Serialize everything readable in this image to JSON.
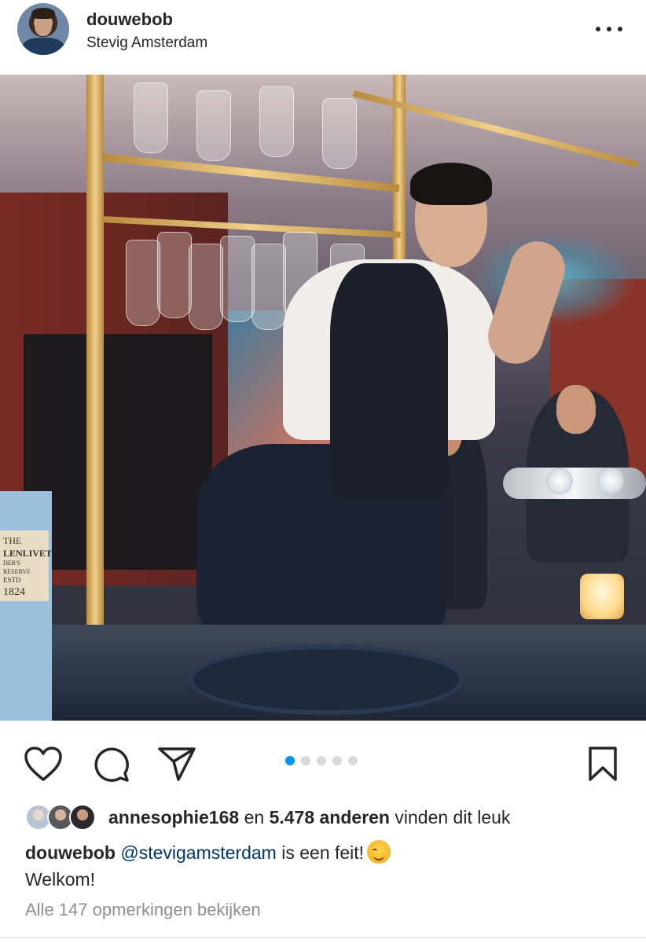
{
  "post": {
    "username": "douwebob",
    "location": "Stevig Amsterdam",
    "menu_icon": "more-dots-icon"
  },
  "photo": {
    "box_label_line1": "THE",
    "box_label_line2": "LENLIVET",
    "box_label_line3": "DER'S RESERVE",
    "box_label_line4": "ESTD",
    "box_label_line5": "1824"
  },
  "carousel": {
    "total": 5,
    "active_index": 0
  },
  "actions": {
    "like_icon": "heart-icon",
    "comment_icon": "comment-icon",
    "share_icon": "send-icon",
    "save_icon": "bookmark-icon"
  },
  "likes": {
    "first_liker": "annesophie168",
    "connector": "en",
    "others": "5.478 anderen",
    "suffix": "vinden dit leuk"
  },
  "caption": {
    "author": "douwebob",
    "mention": "@stevigamsterdam",
    "text": "is een feit!",
    "emoji": "smirk-emoji",
    "line2": "Welkom!"
  },
  "comments": {
    "view_all": "Alle 147 opmerkingen bekijken"
  },
  "colors": {
    "accent": "#0095f6",
    "mention": "#00376b",
    "muted": "#8e8e8e",
    "text": "#262626"
  }
}
